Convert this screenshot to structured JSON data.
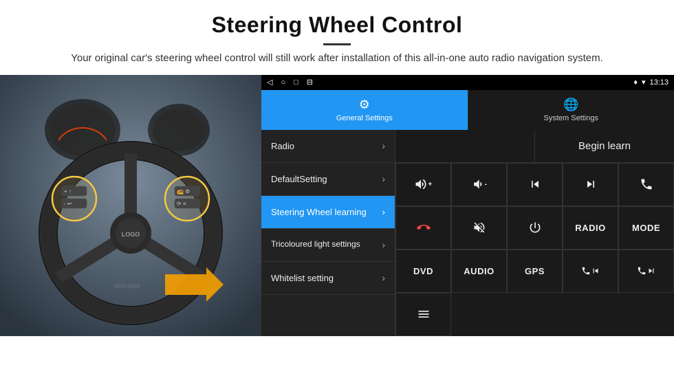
{
  "header": {
    "title": "Steering Wheel Control",
    "subtitle": "Your original car's steering wheel control will still work after installation of this all-in-one auto radio navigation system."
  },
  "status_bar": {
    "left_icons": [
      "◁",
      "○",
      "□",
      "⊟"
    ],
    "time": "13:13",
    "right_icons": [
      "♦",
      "▾"
    ]
  },
  "tabs": [
    {
      "label": "General Settings",
      "active": true,
      "icon": "⚙"
    },
    {
      "label": "System Settings",
      "active": false,
      "icon": "🌐"
    }
  ],
  "menu_items": [
    {
      "label": "Radio",
      "active": false
    },
    {
      "label": "DefaultSetting",
      "active": false
    },
    {
      "label": "Steering Wheel learning",
      "active": true
    },
    {
      "label": "Tricoloured light settings",
      "active": false
    },
    {
      "label": "Whitelist setting",
      "active": false
    }
  ],
  "begin_learn_label": "Begin learn",
  "grid_buttons": [
    {
      "type": "icon",
      "icon": "vol_up",
      "label": "🔊+"
    },
    {
      "type": "icon",
      "icon": "vol_down",
      "label": "🔉-"
    },
    {
      "type": "icon",
      "icon": "prev_track",
      "label": "|◀◀"
    },
    {
      "type": "icon",
      "icon": "next_track",
      "label": "▶▶|"
    },
    {
      "type": "icon",
      "icon": "phone",
      "label": "📞"
    },
    {
      "type": "icon",
      "icon": "hang_up",
      "label": "↩"
    },
    {
      "type": "icon",
      "icon": "mute",
      "label": "🔇×"
    },
    {
      "type": "icon",
      "icon": "power",
      "label": "⏻"
    },
    {
      "type": "text",
      "label": "RADIO"
    },
    {
      "type": "text",
      "label": "MODE"
    },
    {
      "type": "text",
      "label": "DVD"
    },
    {
      "type": "text",
      "label": "AUDIO"
    },
    {
      "type": "text",
      "label": "GPS"
    },
    {
      "type": "icon",
      "icon": "phone_prev",
      "label": "📞◀◀"
    },
    {
      "type": "icon",
      "icon": "phone_next",
      "label": "📞▶▶|"
    },
    {
      "type": "icon",
      "icon": "list",
      "label": "☰"
    }
  ]
}
